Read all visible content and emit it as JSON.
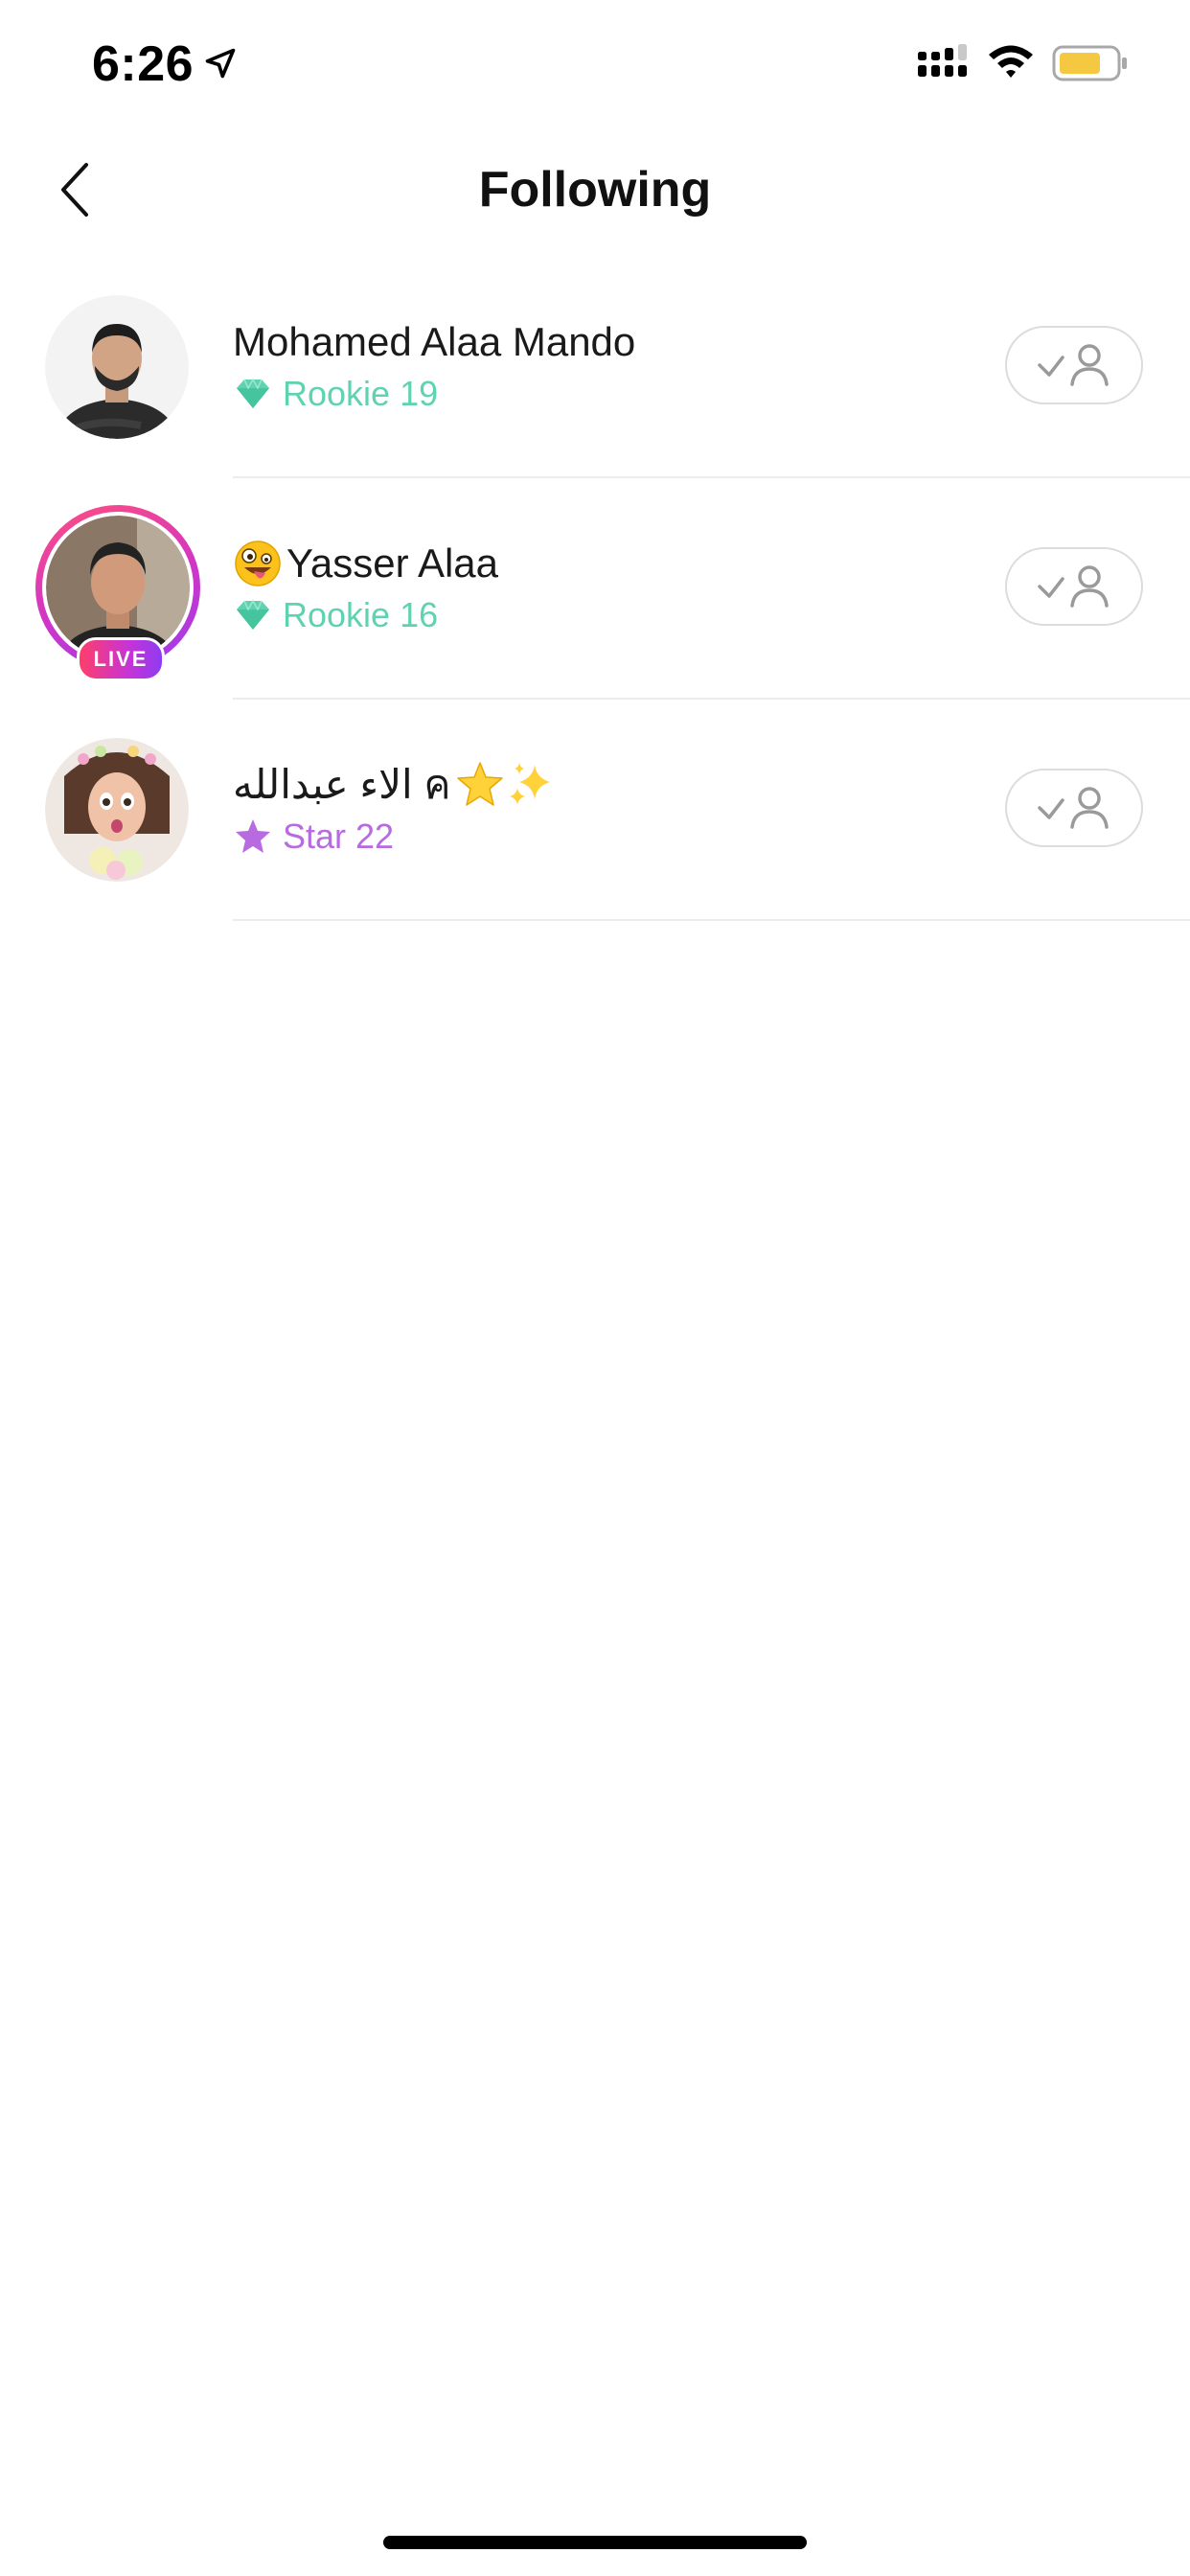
{
  "status_bar": {
    "time": "6:26",
    "icons": [
      "location-arrow-icon",
      "cellular-signal-icon",
      "wifi-icon",
      "battery-icon"
    ],
    "battery_color": "#f5c842"
  },
  "nav": {
    "title": "Following",
    "back_icon": "chevron-left-icon"
  },
  "colors": {
    "rookie": "#5fd3b1",
    "star": "#b86ae0",
    "live_gradient": [
      "#ff3e6a",
      "#c633d6",
      "#8f3bf2"
    ],
    "divider": "#ececec",
    "follow_button_border": "#dcdcdc"
  },
  "following": [
    {
      "name": "Mohamed Alaa Mando",
      "name_prefix_emoji": "",
      "level_icon": "diamond-icon",
      "level": "Rookie 19",
      "is_live": false,
      "follow_button_icon": "following-check-user-icon"
    },
    {
      "name": "Yasser Alaa",
      "name_prefix_emoji": "🤪",
      "level_icon": "diamond-icon",
      "level": "Rookie 16",
      "is_live": true,
      "live_label": "LIVE",
      "follow_button_icon": "following-check-user-icon"
    },
    {
      "name": "الاء عبدالله ค",
      "name_suffix_emojis": "⭐✨",
      "level_icon": "star-icon",
      "level": "Star 22",
      "is_live": false,
      "follow_button_icon": "following-check-user-icon"
    }
  ]
}
